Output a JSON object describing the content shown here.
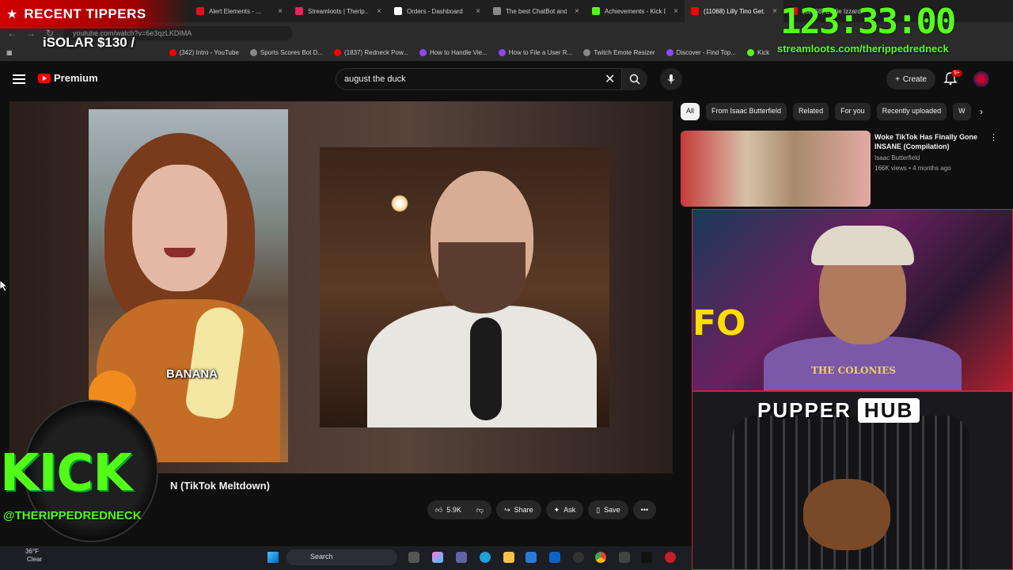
{
  "browser": {
    "tabs": [
      {
        "label": "Alert Elements - ...",
        "color": "#d12",
        "active": false
      },
      {
        "label": "Streamloots | Therip...",
        "color": "#e8245a",
        "active": false
      },
      {
        "label": "Orders - Dashboard",
        "color": "#ffffff",
        "active": false
      },
      {
        "label": "The best ChatBot and...",
        "color": "#8a8a8a",
        "active": false
      },
      {
        "label": "Achievements - Kick D...",
        "color": "#53fc18",
        "active": false
      },
      {
        "label": "(11068) Lilly Tino Get...",
        "color": "#ff0000",
        "active": true
      },
      {
        "label": "(11068) Eddie Izzard...",
        "color": "#ff0000",
        "active": false
      }
    ],
    "url": "youtube.com/watch?v=6e3qzLKDIMA",
    "bookmarks": [
      {
        "label": "(342) Intro - YouTube",
        "color": "#ff0000"
      },
      {
        "label": "Sports Scores Bot D...",
        "color": "#888888"
      },
      {
        "label": "(1837) Redneck Pow...",
        "color": "#ff0000"
      },
      {
        "label": "How to Handle Vie...",
        "color": "#9146ff"
      },
      {
        "label": "How to File a User R...",
        "color": "#9146ff"
      },
      {
        "label": "Twitch Emote Resizer",
        "color": "#888888"
      },
      {
        "label": "Discover - Find Top...",
        "color": "#9146ff"
      },
      {
        "label": "Kick",
        "color": "#53fc18"
      }
    ]
  },
  "youtube": {
    "logo_label": "Premium",
    "search_value": "august the duck",
    "create_label": "Create",
    "notification_badge": "9+",
    "video_caption": "BANANA",
    "video_title": "N (TikTok Meltdown)",
    "actions": {
      "like_count": "5.9K",
      "share_label": "Share",
      "ask_label": "Ask",
      "save_label": "Save"
    },
    "chips": [
      "All",
      "From Isaac Butterfield",
      "Related",
      "For you",
      "Recently uploaded",
      "W"
    ],
    "recommendation": {
      "title": "Woke TikTok Has Finally Gone INSANE (Compilation)",
      "channel": "Isaac Butterfield",
      "meta": "166K views • 4 months ago"
    }
  },
  "overlay": {
    "tippers_label": "RECENT TIPPERS",
    "tipper_entry": "iSOLAR $130 /",
    "timer": "123:33:00",
    "timer_url": "streamloots.com/therippedredneck",
    "webcam_shirt": "THE COLONIES",
    "webcam_sign": "FO",
    "pupper_label_a": "PUPPER",
    "pupper_label_b": "HUB",
    "kick_label": "KICK",
    "kick_handle": "@THERIPPEDREDNECK",
    "accent_green": "#53fc18",
    "accent_red": "#cc0000"
  },
  "taskbar": {
    "temperature": "36°F",
    "condition": "Clear",
    "search_label": "Search"
  }
}
